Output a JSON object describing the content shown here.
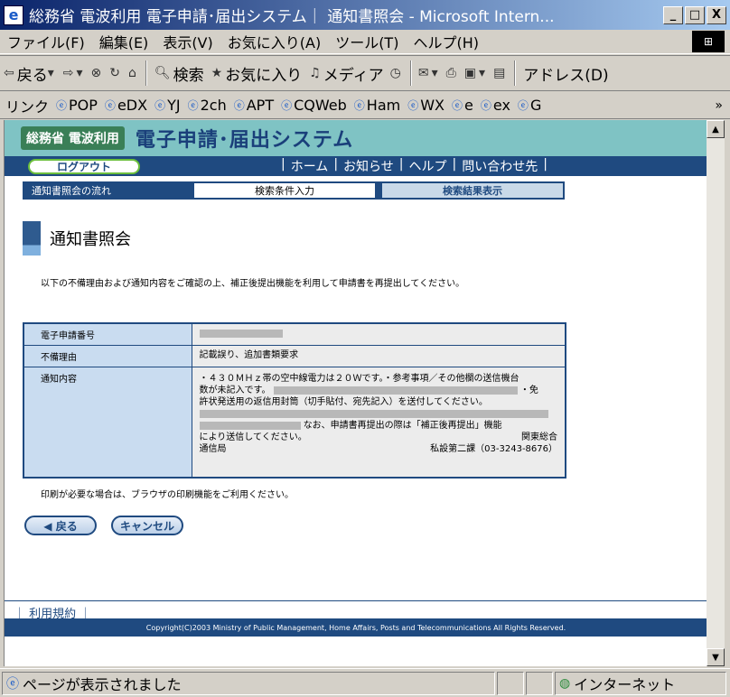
{
  "window": {
    "title": "総務省 電波利用 電子申請･届出システム｜ 通知書照会 - Microsoft Intern...",
    "minimize": "_",
    "maximize": "□",
    "close": "X"
  },
  "menu": [
    "ファイル(F)",
    "編集(E)",
    "表示(V)",
    "お気に入り(A)",
    "ツール(T)",
    "ヘルプ(H)"
  ],
  "toolbar": {
    "back": "戻る",
    "search": "検索",
    "favorites": "お気に入り",
    "media": "メディア",
    "address": "アドレス(D)"
  },
  "links": {
    "label": "リンク",
    "items": [
      "POP",
      "eDX",
      "YJ",
      "2ch",
      "APT",
      "CQWeb",
      "Ham",
      "WX",
      "e",
      "ex",
      "G"
    ],
    "more": "»"
  },
  "site": {
    "brand_small": "総務省 電波利用",
    "brand_main": "電子申請･届出システム",
    "logout": "ログアウト",
    "nav": [
      "ホーム",
      "お知らせ",
      "ヘルプ",
      "問い合わせ先"
    ]
  },
  "flow": {
    "label": "通知書照会の流れ",
    "step1": "検索条件入力",
    "step2": "検索結果表示"
  },
  "page": {
    "title": "通知書照会",
    "notice": "以下の不備理由および通知内容をご確認の上、補正後提出機能を利用して申請書を再提出してください。",
    "print_note": "印刷が必要な場合は、ブラウザの印刷機能をご利用ください。"
  },
  "table": {
    "row1_label": "電子申請番号",
    "row2_label": "不備理由",
    "row2_value": "記載誤り、追加書類要求",
    "row3_label": "通知内容",
    "row3_line1": "・４３０ＭＨｚ帯の空中線電力は２０Ｗです。・参考事項／その他欄の送信機台",
    "row3_line2a": "数が未記入です。",
    "row3_line2b": "・免",
    "row3_line3": "許状発送用の返信用封筒（切手貼付、宛先記入）を送付してください。",
    "row3_line4": "なお、申請書再提出の際は「補正後再提出」機能",
    "row3_line5a": "により送信してください。",
    "row3_line5b": "関東総合",
    "row3_line6a": "通信局",
    "row3_line6b": "私設第二課（03-3243-8676）"
  },
  "buttons": {
    "back": "◀ 戻る",
    "cancel": "キャンセル"
  },
  "footer": {
    "links": "｜ 利用規約 ｜",
    "copyright": "Copyright(C)2003 Ministry of Public Management, Home Affairs, Posts and Telecommunications All Rights Reserved."
  },
  "status": {
    "message": "ページが表示されました",
    "zone": "インターネット"
  }
}
